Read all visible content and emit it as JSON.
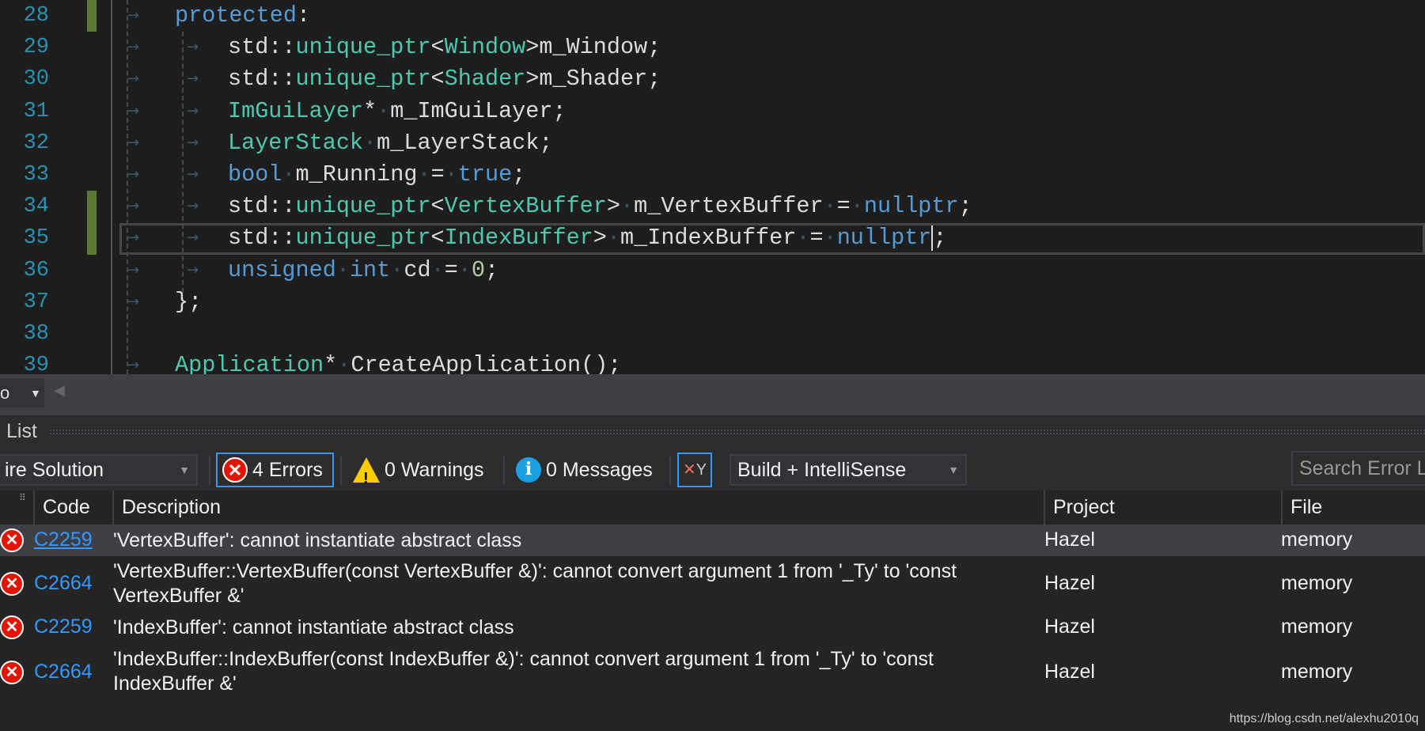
{
  "editor": {
    "lines": [
      {
        "num": "28",
        "indent": 1,
        "changed": true,
        "tokens": [
          {
            "t": "protected",
            "c": "kw"
          },
          {
            "t": ":",
            "c": "pl"
          }
        ]
      },
      {
        "num": "29",
        "indent": 2,
        "tokens": [
          {
            "t": "std::",
            "c": "pl"
          },
          {
            "t": "unique_ptr",
            "c": "ty"
          },
          {
            "t": "<",
            "c": "pl"
          },
          {
            "t": "Window",
            "c": "ty"
          },
          {
            "t": ">m_Window;",
            "c": "pl"
          }
        ]
      },
      {
        "num": "30",
        "indent": 2,
        "tokens": [
          {
            "t": "std::",
            "c": "pl"
          },
          {
            "t": "unique_ptr",
            "c": "ty"
          },
          {
            "t": "<",
            "c": "pl"
          },
          {
            "t": "Shader",
            "c": "ty"
          },
          {
            "t": ">m_Shader;",
            "c": "pl"
          }
        ]
      },
      {
        "num": "31",
        "indent": 2,
        "tokens": [
          {
            "t": "ImGuiLayer",
            "c": "ty"
          },
          {
            "t": "*",
            "c": "pl"
          },
          {
            "t": "·",
            "c": "dot"
          },
          {
            "t": "m_ImGuiLayer;",
            "c": "pl"
          }
        ]
      },
      {
        "num": "32",
        "indent": 2,
        "tokens": [
          {
            "t": "LayerStack",
            "c": "ty"
          },
          {
            "t": "·",
            "c": "dot"
          },
          {
            "t": "m_LayerStack;",
            "c": "pl"
          }
        ]
      },
      {
        "num": "33",
        "indent": 2,
        "tokens": [
          {
            "t": "bool",
            "c": "kw"
          },
          {
            "t": "·",
            "c": "dot"
          },
          {
            "t": "m_Running",
            "c": "pl"
          },
          {
            "t": "·",
            "c": "dot"
          },
          {
            "t": "=",
            "c": "pl"
          },
          {
            "t": "·",
            "c": "dot"
          },
          {
            "t": "true",
            "c": "kw"
          },
          {
            "t": ";",
            "c": "pl"
          }
        ]
      },
      {
        "num": "34",
        "indent": 2,
        "changed": true,
        "tokens": [
          {
            "t": "std::",
            "c": "pl"
          },
          {
            "t": "unique_ptr",
            "c": "ty"
          },
          {
            "t": "<",
            "c": "pl"
          },
          {
            "t": "VertexBuffer",
            "c": "ty"
          },
          {
            "t": ">",
            "c": "pl"
          },
          {
            "t": "·",
            "c": "dot"
          },
          {
            "t": "m_VertexBuffer",
            "c": "pl"
          },
          {
            "t": "·",
            "c": "dot"
          },
          {
            "t": "=",
            "c": "pl"
          },
          {
            "t": "·",
            "c": "dot"
          },
          {
            "t": "nullptr",
            "c": "kw"
          },
          {
            "t": ";",
            "c": "pl"
          }
        ]
      },
      {
        "num": "35",
        "indent": 2,
        "changed": true,
        "current": true,
        "tokens": [
          {
            "t": "std::",
            "c": "pl"
          },
          {
            "t": "unique_ptr",
            "c": "ty"
          },
          {
            "t": "<",
            "c": "pl"
          },
          {
            "t": "IndexBuffer",
            "c": "ty"
          },
          {
            "t": ">",
            "c": "pl"
          },
          {
            "t": "·",
            "c": "dot"
          },
          {
            "t": "m_IndexBuffer",
            "c": "pl"
          },
          {
            "t": "·",
            "c": "dot"
          },
          {
            "t": "=",
            "c": "pl"
          },
          {
            "t": "·",
            "c": "dot"
          },
          {
            "t": "nullptr",
            "c": "kw"
          },
          {
            "t": "|",
            "c": "caret"
          },
          {
            "t": ";",
            "c": "pl"
          }
        ]
      },
      {
        "num": "36",
        "indent": 2,
        "tokens": [
          {
            "t": "unsigned",
            "c": "kw"
          },
          {
            "t": "·",
            "c": "dot"
          },
          {
            "t": "int",
            "c": "kw"
          },
          {
            "t": "·",
            "c": "dot"
          },
          {
            "t": "cd",
            "c": "pl"
          },
          {
            "t": "·",
            "c": "dot"
          },
          {
            "t": "=",
            "c": "pl"
          },
          {
            "t": "·",
            "c": "dot"
          },
          {
            "t": "0",
            "c": "nm"
          },
          {
            "t": ";",
            "c": "pl"
          }
        ]
      },
      {
        "num": "37",
        "indent": 1,
        "tokens": [
          {
            "t": "};",
            "c": "pl"
          }
        ]
      },
      {
        "num": "38",
        "indent": 0,
        "tokens": []
      },
      {
        "num": "39",
        "indent": 1,
        "tokens": [
          {
            "t": "Application",
            "c": "ty"
          },
          {
            "t": "*",
            "c": "pl"
          },
          {
            "t": "·",
            "c": "dot"
          },
          {
            "t": "CreateApplication();",
            "c": "pl"
          }
        ]
      }
    ]
  },
  "navbar": {
    "dropdown_value": "o"
  },
  "error_list": {
    "title": "List",
    "scope_value": "ire Solution",
    "errors_label": "4 Errors",
    "warnings_label": "0 Warnings",
    "messages_label": "0 Messages",
    "source_value": "Build + IntelliSense",
    "search_placeholder": "Search Error List",
    "columns": {
      "code": "Code",
      "description": "Description",
      "project": "Project",
      "file": "File"
    },
    "rows": [
      {
        "code": "C2259",
        "description": "'VertexBuffer': cannot instantiate abstract class",
        "project": "Hazel",
        "file": "memory",
        "selected": true
      },
      {
        "code": "C2664",
        "description": "'VertexBuffer::VertexBuffer(const VertexBuffer &)': cannot convert argument 1 from '_Ty' to 'const VertexBuffer &'",
        "project": "Hazel",
        "file": "memory"
      },
      {
        "code": "C2259",
        "description": "'IndexBuffer': cannot instantiate abstract class",
        "project": "Hazel",
        "file": "memory"
      },
      {
        "code": "C2664",
        "description": "'IndexBuffer::IndexBuffer(const IndexBuffer &)': cannot convert argument 1 from '_Ty' to 'const IndexBuffer &'",
        "project": "Hazel",
        "file": "memory"
      }
    ]
  },
  "watermark": "https://blog.csdn.net/alexhu2010q",
  "colors": {
    "keyword": "#569cd6",
    "type": "#4ec9b0",
    "line_number": "#2b91af",
    "error": "#e51400",
    "accent": "#3399ff"
  }
}
